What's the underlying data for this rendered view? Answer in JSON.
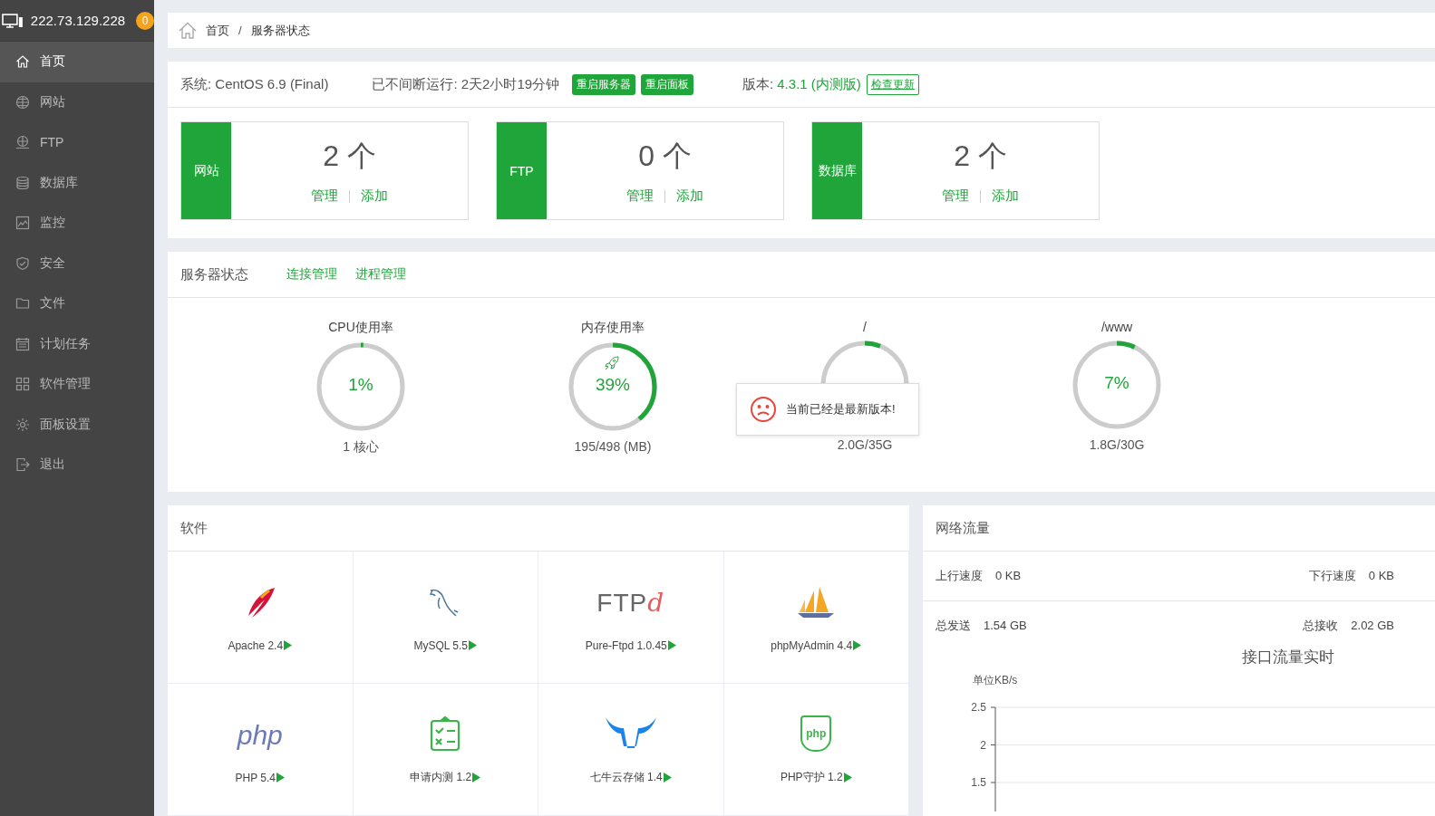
{
  "sidebar": {
    "host": "222.73.129.228",
    "badge": "0",
    "items": [
      {
        "label": "首页",
        "kind": "home",
        "selected": true
      },
      {
        "label": "网站",
        "kind": "globe",
        "selected": false
      },
      {
        "label": "FTP",
        "kind": "ftp",
        "selected": false
      },
      {
        "label": "数据库",
        "kind": "database",
        "selected": false
      },
      {
        "label": "监控",
        "kind": "monitor",
        "selected": false
      },
      {
        "label": "安全",
        "kind": "shield",
        "selected": false
      },
      {
        "label": "文件",
        "kind": "folder",
        "selected": false
      },
      {
        "label": "计划任务",
        "kind": "calendar",
        "selected": false
      },
      {
        "label": "软件管理",
        "kind": "grid",
        "selected": false
      },
      {
        "label": "面板设置",
        "kind": "gear",
        "selected": false
      },
      {
        "label": "退出",
        "kind": "logout",
        "selected": false
      }
    ]
  },
  "breadcrumb": {
    "items": [
      "首页",
      "服务器状态"
    ],
    "separator": "/"
  },
  "system_bar": {
    "system": "系统: CentOS 6.9 (Final)",
    "uptime": "已不间断运行: 2天2小时19分钟",
    "buttons": [
      "重启服务器",
      "重启面板"
    ],
    "version_label": "版本:",
    "version": "4.3.1 (内测版)",
    "update_button": "检查更新"
  },
  "stats": [
    {
      "label": "网站",
      "count": "2 个",
      "links": [
        "管理",
        "添加"
      ]
    },
    {
      "label": "FTP",
      "count": "0 个",
      "links": [
        "管理",
        "添加"
      ]
    },
    {
      "label": "数据库",
      "count": "2 个",
      "links": [
        "管理",
        "添加"
      ]
    }
  ],
  "server_status": {
    "title": "服务器状态",
    "links": [
      "连接管理",
      "进程管理"
    ],
    "gauges": [
      {
        "label": "CPU使用率",
        "value": "1%",
        "level": 0.01,
        "detail": "1 核心",
        "rocket": false
      },
      {
        "label": "内存使用率",
        "value": "39%",
        "level": 0.39,
        "detail": "195/498 (MB)",
        "rocket": true
      },
      {
        "label": "/",
        "level": 0.06,
        "detail": "2.0G/35G",
        "rocket": false
      },
      {
        "label": "/www",
        "value": "7%",
        "level": 0.07,
        "detail": "1.8G/30G",
        "rocket": false
      }
    ]
  },
  "toast": {
    "message": "当前已经是最新版本!"
  },
  "software": {
    "title": "软件",
    "items": [
      {
        "name": "Apache 2.4",
        "kind": "feather"
      },
      {
        "name": "MySQL 5.5",
        "kind": "dolphin"
      },
      {
        "name": "Pure-Ftpd 1.0.45",
        "kind": "wordmark",
        "logo_text": "FTP",
        "logo_accent": "d"
      },
      {
        "name": "phpMyAdmin 4.4",
        "kind": "sails"
      },
      {
        "name": "PHP 5.4",
        "kind": "wordmark-php",
        "logo_text": "php"
      },
      {
        "name": "申请内测 1.2",
        "kind": "clipboard"
      },
      {
        "name": "七牛云存储 1.4",
        "kind": "bull"
      },
      {
        "name": "PHP守护 1.2",
        "kind": "shield",
        "logo_text": "php"
      }
    ]
  },
  "network": {
    "title": "网络流量",
    "stats": [
      {
        "label": "上行速度",
        "value": "0 KB"
      },
      {
        "label": "下行速度",
        "value": "0 KB"
      },
      {
        "label": "总发送",
        "value": "1.54 GB"
      },
      {
        "label": "总接收",
        "value": "2.02 GB"
      }
    ],
    "traffic_chart": {
      "title": "接口流量实时",
      "unit": "单位KB/s",
      "tick_labels": [
        "2.5",
        "2",
        "1.5"
      ]
    }
  }
}
